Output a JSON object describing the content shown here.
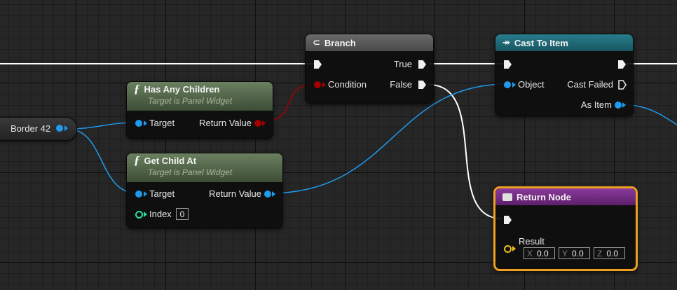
{
  "variable": {
    "label": "Border 42",
    "pin_color": "#1e9bee"
  },
  "branch": {
    "title": "Branch",
    "icon": "branch-icon",
    "header_color": "#5b5b5b",
    "true_label": "True",
    "false_label": "False",
    "condition_label": "Condition"
  },
  "has_children": {
    "title": "Has Any Children",
    "subtitle": "Target is Panel Widget",
    "icon": "function-icon",
    "header_color": "#5a6f4f",
    "target_label": "Target",
    "return_label": "Return Value"
  },
  "get_child": {
    "title": "Get Child At",
    "subtitle": "Target is Panel Widget",
    "icon": "function-icon",
    "header_color": "#5a6f4f",
    "target_label": "Target",
    "return_label": "Return Value",
    "index_label": "Index",
    "index_value": "0"
  },
  "cast": {
    "title": "Cast To Item",
    "icon": "cast-icon",
    "header_color": "#1f6a78",
    "object_label": "Object",
    "failed_label": "Cast Failed",
    "as_label": "As Item"
  },
  "return_node": {
    "title": "Return Node",
    "icon": "return-icon",
    "header_color": "#7a2a8a",
    "border_color": "#f0a020",
    "result_label": "Result",
    "x_label": "X",
    "x_value": "0.0",
    "y_label": "Y",
    "y_value": "0.0",
    "z_label": "Z",
    "z_value": "0.0"
  },
  "colors": {
    "object_pin": "#1e9bee",
    "bool_pin": "#a50000",
    "int_pin": "#1fe0a8",
    "vector_pin": "#f0c020",
    "exec_wire": "#ffffff"
  }
}
